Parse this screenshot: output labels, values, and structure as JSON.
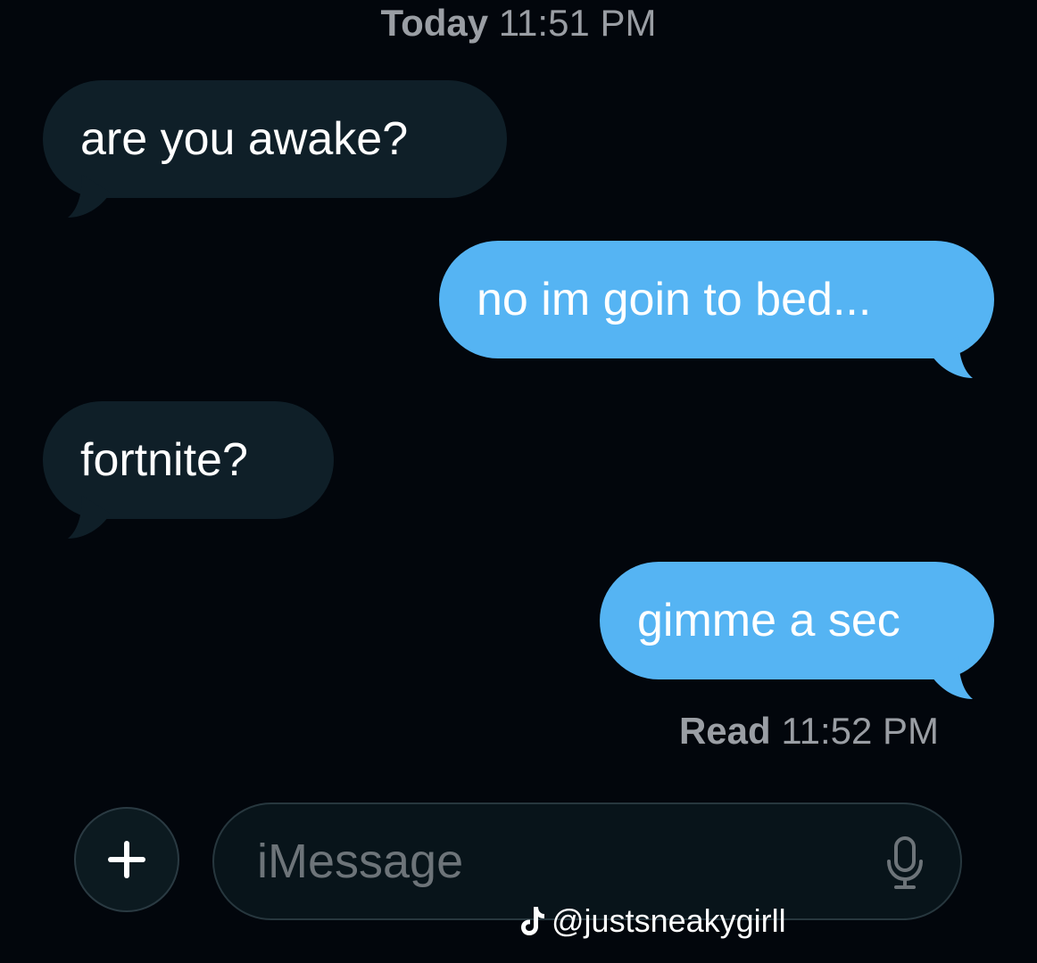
{
  "header": {
    "day": "Today",
    "time": "11:51 PM"
  },
  "messages": [
    {
      "direction": "incoming",
      "text": "are you awake?"
    },
    {
      "direction": "outgoing",
      "text": "no im goin to bed..."
    },
    {
      "direction": "incoming",
      "text": "fortnite?"
    },
    {
      "direction": "outgoing",
      "text": "gimme a sec"
    }
  ],
  "receipt": {
    "status": "Read",
    "time": "11:52 PM"
  },
  "composer": {
    "plus_symbol": "+",
    "placeholder": "iMessage",
    "mic_icon": "mic-icon"
  },
  "watermark": {
    "handle": "@justsneakygirll",
    "logo_icon": "tiktok-logo-icon"
  },
  "colors": {
    "background": "#02060c",
    "incoming_bubble": "#0f1f28",
    "outgoing_bubble": "#55b4f3",
    "meta_text": "#9a9ea4"
  }
}
